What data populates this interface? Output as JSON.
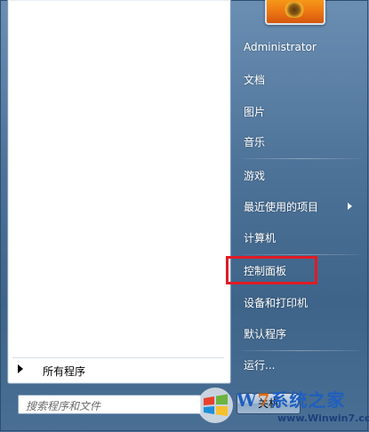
{
  "left_pane": {
    "all_programs": "所有程序",
    "search_placeholder": "搜索程序和文件"
  },
  "right_menu": {
    "user": "Administrator",
    "items": [
      {
        "label": "文档"
      },
      {
        "label": "图片"
      },
      {
        "label": "音乐"
      },
      {
        "label": "游戏"
      },
      {
        "label": "最近使用的项目"
      },
      {
        "label": "计算机"
      },
      {
        "label": "控制面板"
      },
      {
        "label": "设备和打印机"
      },
      {
        "label": "默认程序"
      },
      {
        "label": "运行..."
      }
    ],
    "shutdown": "关机"
  },
  "watermark": {
    "brand_w": "W",
    "brand_7": "7",
    "brand_cn": "系统之家",
    "url": "www.Winwin7.com"
  },
  "colors": {
    "highlight": "#e01b24",
    "menu_bg": "#4e7399"
  }
}
